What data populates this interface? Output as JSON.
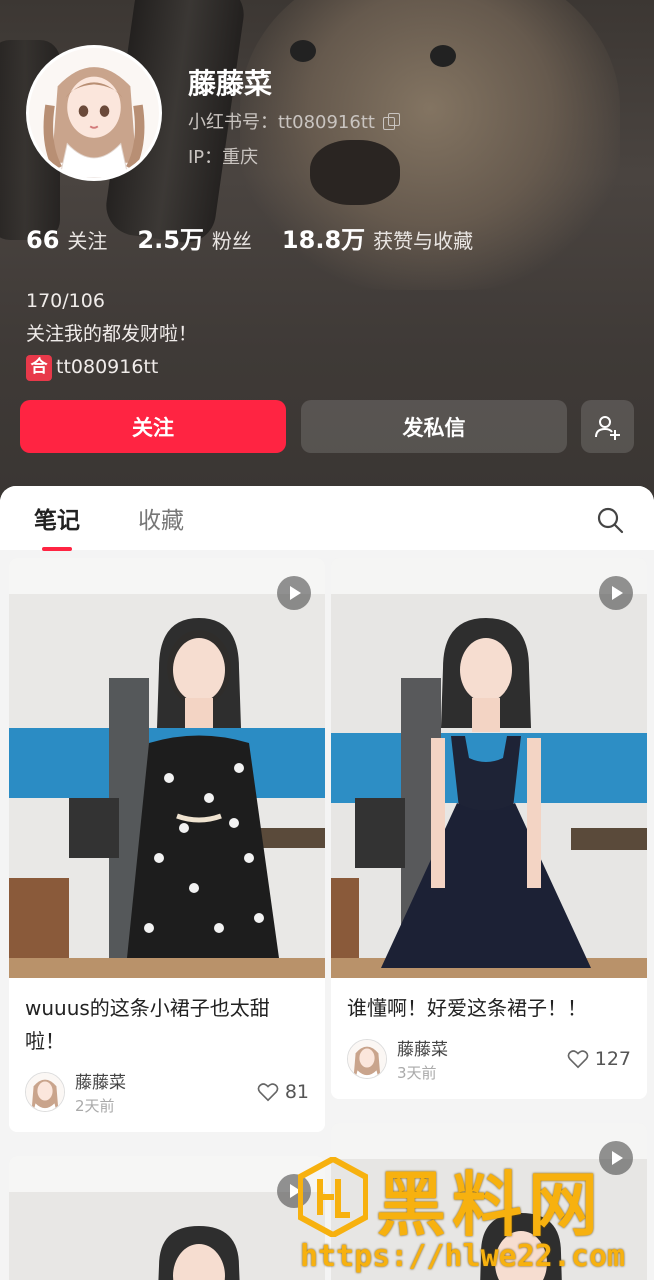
{
  "profile": {
    "nickname": "藤藤菜",
    "account_id": "小红书号：tt080916tt",
    "ip": "IP：重庆",
    "stats": [
      {
        "num": "66",
        "label": "关注"
      },
      {
        "num": "2.5万",
        "label": "粉丝"
      },
      {
        "num": "18.8万",
        "label": "获赞与收藏"
      }
    ],
    "bio": {
      "line1": "170/106",
      "line2": "关注我的都发财啦！",
      "tag_char": "合",
      "line3": "tt080916tt"
    },
    "buttons": {
      "follow": "关注",
      "message": "发私信"
    }
  },
  "tabs": [
    {
      "label": "笔记"
    },
    {
      "label": "收藏"
    }
  ],
  "notes": [
    {
      "title": "wuuus的这条小裙子也太甜啦！",
      "author": "藤藤菜",
      "time": "2天前",
      "likes": "81",
      "is_video": true
    },
    {
      "title": "谁懂啊！好爱这条裙子！！",
      "author": "藤藤菜",
      "time": "3天前",
      "likes": "127",
      "is_video": true
    },
    {
      "title": "",
      "author": "",
      "time": "",
      "likes": "",
      "is_video": false
    },
    {
      "title": "",
      "author": "",
      "time": "",
      "likes": "",
      "is_video": true
    }
  ],
  "watermark": {
    "brand": "黑料网",
    "url": "https://hlwe22.com"
  },
  "colors": {
    "accent": "#ff2442",
    "watermark": "#f7b10f"
  },
  "icons": {
    "copy": "copy-icon",
    "add_friend": "add-friend-icon",
    "search": "search-icon",
    "play": "play-icon",
    "heart": "heart-icon"
  }
}
